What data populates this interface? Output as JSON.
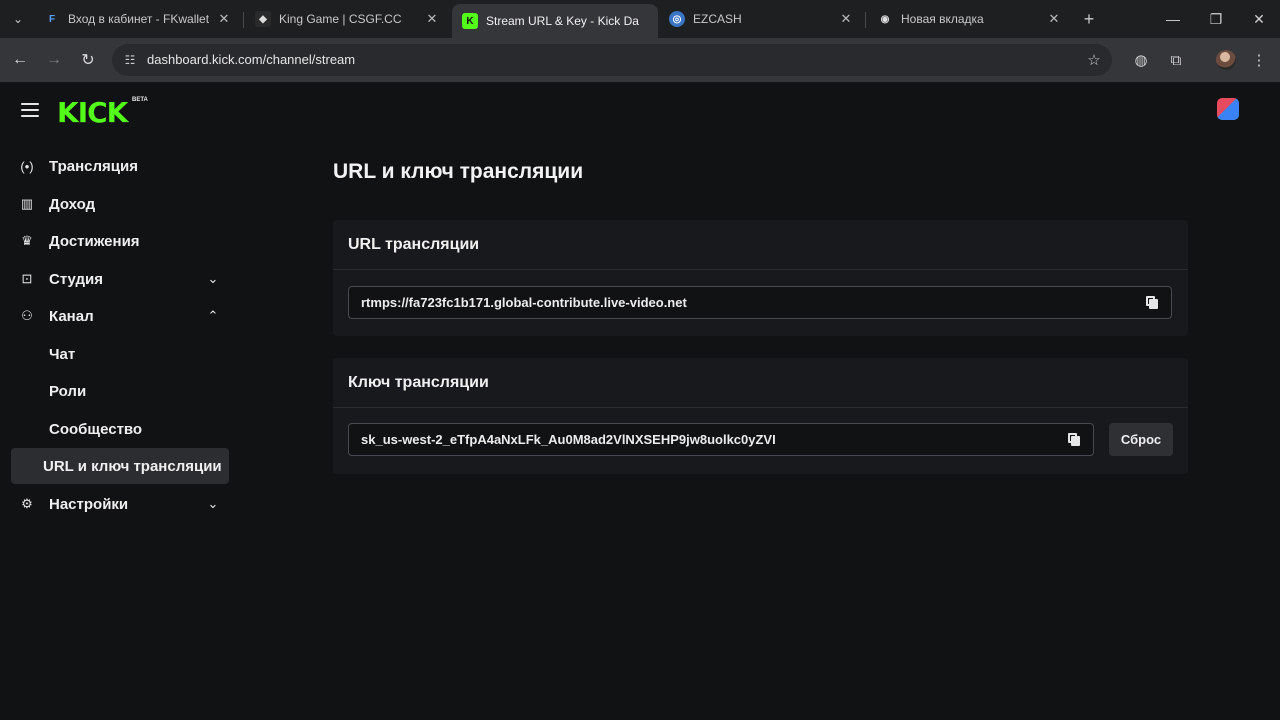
{
  "browser": {
    "tabs": [
      {
        "title": "Вход в кабинет - FKwallet",
        "favicon": "fk-icon",
        "active": false
      },
      {
        "title": "King Game | CSGF.CC",
        "favicon": "shield-icon",
        "active": false
      },
      {
        "title": "Stream URL & Key - Kick Da",
        "favicon": "kick-icon",
        "active": true
      },
      {
        "title": "EZCASH",
        "favicon": "globe-icon",
        "active": false
      },
      {
        "title": "Новая вкладка",
        "favicon": "chrome-icon",
        "active": false
      }
    ],
    "url": "dashboard.kick.com/channel/stream"
  },
  "header": {
    "logo_text": "KICK",
    "logo_badge": "BETA"
  },
  "sidebar": {
    "items": [
      {
        "label": "Трансляция",
        "icon": "broadcast-icon"
      },
      {
        "label": "Доход",
        "icon": "chart-icon"
      },
      {
        "label": "Достижения",
        "icon": "trophy-icon"
      },
      {
        "label": "Студия",
        "icon": "studio-icon",
        "chevron": "down"
      },
      {
        "label": "Канал",
        "icon": "users-icon",
        "chevron": "up"
      },
      {
        "label": "Настройки",
        "icon": "gear-icon",
        "chevron": "down"
      }
    ],
    "sub_items": [
      "Чат",
      "Роли",
      "Сообщество",
      "URL и ключ трансляции"
    ],
    "active_sub": "URL и ключ трансляции"
  },
  "main": {
    "title": "URL и ключ трансляции",
    "url_section": {
      "heading": "URL трансляции",
      "value": "rtmps://fa723fc1b171.global-contribute.live-video.net"
    },
    "key_section": {
      "heading": "Ключ трансляции",
      "value": "sk_us-west-2_eTfpA4aNxLFk_Au0M8ad2VlNXSEHP9jw8uolkc0yZVI",
      "reset_label": "Сброс"
    }
  },
  "colors": {
    "accent": "#53fc18",
    "background": "#111214",
    "card": "#18191c"
  }
}
